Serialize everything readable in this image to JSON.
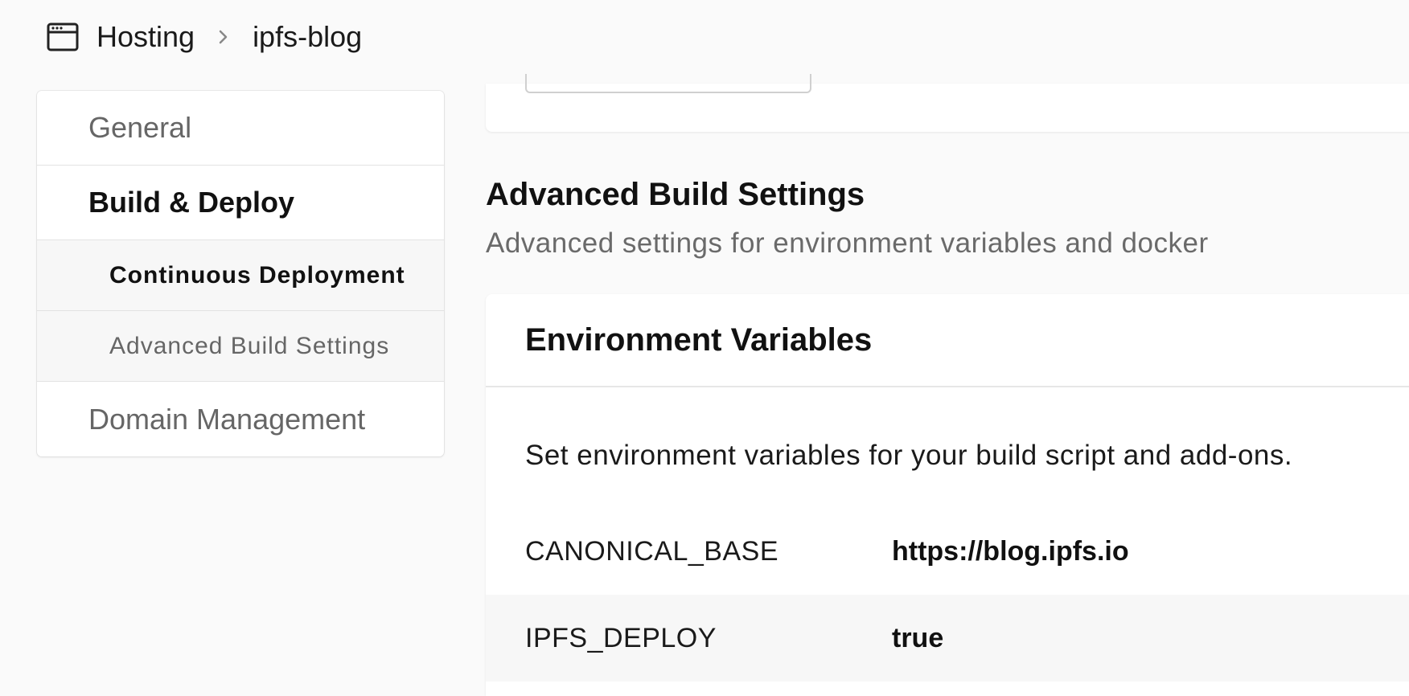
{
  "breadcrumb": {
    "icon": "browser-window-icon",
    "section": "Hosting",
    "separator_icon": "chevron-right-icon",
    "site": "ipfs-blog"
  },
  "sidebar": {
    "items": [
      {
        "label": "General",
        "active": false
      },
      {
        "label": "Build & Deploy",
        "active": true
      },
      {
        "label": "Continuous Deployment",
        "sub": true,
        "active": true
      },
      {
        "label": "Advanced Build Settings",
        "sub": true,
        "active": false
      },
      {
        "label": "Domain Management",
        "active": false
      }
    ]
  },
  "main": {
    "section_title": "Advanced Build Settings",
    "section_subtitle": "Advanced settings for environment variables and docker",
    "env_card": {
      "title": "Environment Variables",
      "description": "Set environment variables for your build script and add-ons.",
      "variables": [
        {
          "key": "CANONICAL_BASE",
          "value": "https://blog.ipfs.io"
        },
        {
          "key": "IPFS_DEPLOY",
          "value": "true"
        }
      ]
    }
  },
  "colors": {
    "background": "#fafafa",
    "card": "#ffffff",
    "muted_text": "#666666",
    "row_alt": "#f7f7f7"
  }
}
